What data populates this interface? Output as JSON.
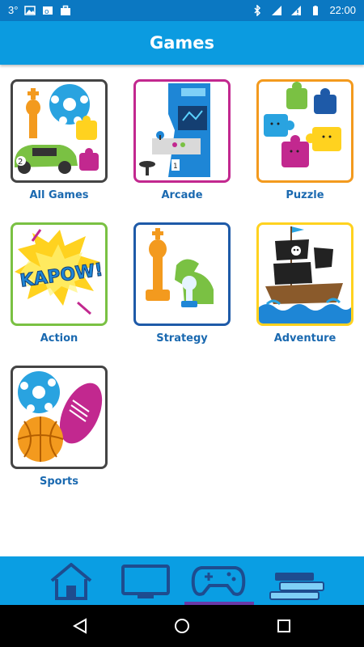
{
  "status": {
    "notification_count": "3°",
    "time": "22:00"
  },
  "header": {
    "title": "Games"
  },
  "categories": [
    {
      "label": "All Games"
    },
    {
      "label": "Arcade"
    },
    {
      "label": "Puzzle"
    },
    {
      "label": "Action"
    },
    {
      "label": "Strategy"
    },
    {
      "label": "Adventure"
    },
    {
      "label": "Sports"
    }
  ],
  "kapow_text": "KAPOW!",
  "colors": {
    "accent": "#0b9be0",
    "status_bar": "#0b78c2",
    "label": "#1a69b0",
    "frame_default": "#444444",
    "frame_arcade": "#c2288f",
    "frame_puzzle": "#f39a1e",
    "frame_action": "#7ac143",
    "frame_strategy": "#1e5aa8",
    "frame_adventure": "#ffd21f",
    "selected_indicator": "#6a39a8"
  },
  "bottom_nav": [
    {
      "icon": "home-icon"
    },
    {
      "icon": "tv-icon"
    },
    {
      "icon": "gamepad-icon",
      "selected": true
    },
    {
      "icon": "books-icon"
    }
  ]
}
